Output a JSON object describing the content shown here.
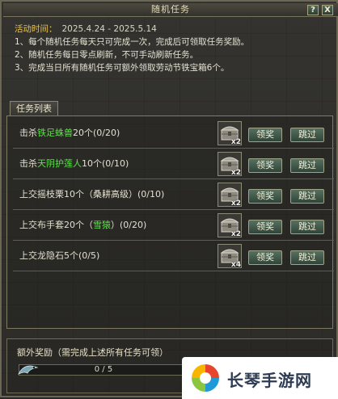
{
  "window": {
    "title": "随机任务",
    "help_label": "?",
    "close_label": "X"
  },
  "info": {
    "time_label": "活动时间：",
    "time_range": "2025.4.24 - 2025.5.14",
    "rules": [
      "1、每个随机任务每天只可完成一次，完成后可领取任务奖励。",
      "2、随机任务每日零点刷新，不可手动刷新任务。",
      "3、完成当日所有随机任务可额外领取劳动节铁宝箱6个。"
    ]
  },
  "tabs": {
    "task_list": "任务列表"
  },
  "tasks": [
    {
      "prefix": "击杀",
      "highlight": "铁足蛛兽",
      "suffix": "20个(0/20)",
      "reward_count": "x2",
      "claim": "领奖",
      "skip": "跳过"
    },
    {
      "prefix": "击杀",
      "highlight": "天阴护莲人",
      "suffix": "10个(0/10)",
      "reward_count": "x2",
      "claim": "领奖",
      "skip": "跳过"
    },
    {
      "prefix": "上交摇枝栗10个（桑耕高级）(0/10)",
      "highlight": "",
      "suffix": "",
      "reward_count": "x2",
      "claim": "领奖",
      "skip": "跳过"
    },
    {
      "prefix": "上交布手套20个（",
      "highlight": "雪猿",
      "suffix": "）(0/20)",
      "reward_count": "x2",
      "claim": "领奖",
      "skip": "跳过"
    },
    {
      "prefix": "上交龙隐石5个(0/5)",
      "highlight": "",
      "suffix": "",
      "reward_count": "x4",
      "claim": "领奖",
      "skip": "跳过"
    }
  ],
  "bonus": {
    "title": "额外奖励（需完成上述所有任务可领）",
    "progress_text": "0 / 5",
    "progress_fraction": 0
  },
  "watermark": {
    "text": "长琴手游网"
  },
  "colors": {
    "highlight": "#5ee04a",
    "label": "#e7c24d",
    "button": "#3f5a4a"
  }
}
